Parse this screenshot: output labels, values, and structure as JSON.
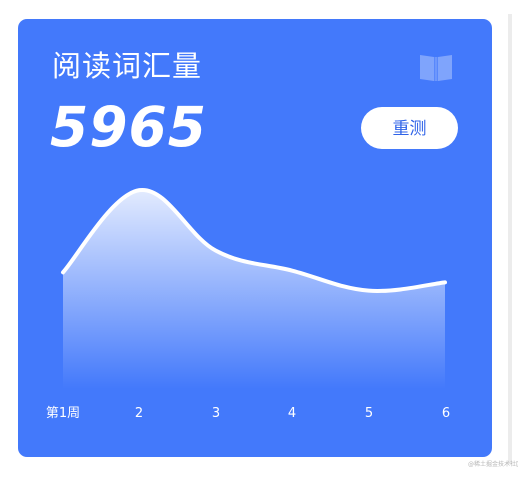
{
  "card": {
    "title": "阅读词汇量",
    "value": "5965",
    "retest_label": "重测",
    "background_color": "#4379fb",
    "icon": "book-icon"
  },
  "chart_data": {
    "type": "area",
    "categories": [
      "第1周",
      "2",
      "3",
      "4",
      "5",
      "6"
    ],
    "series": [
      {
        "values": [
          3500,
          5965,
          4150,
          3550,
          2950,
          3200
        ]
      }
    ],
    "ylim": [
      0,
      7500
    ],
    "grid": false,
    "line_color": "#ffffff"
  },
  "watermark": "@稀土掘金技术社区"
}
